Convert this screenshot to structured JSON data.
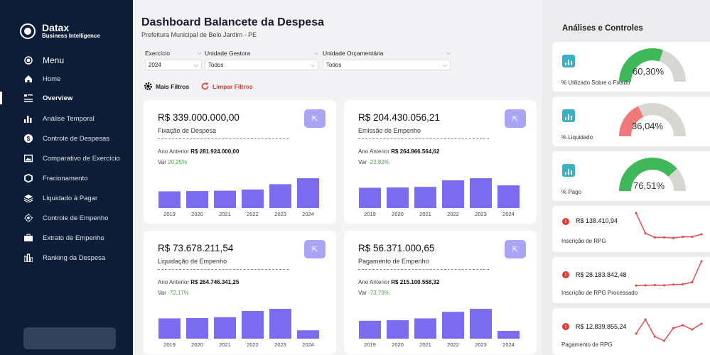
{
  "sidebar": {
    "brand_name": "Datax",
    "brand_sub": "Business Intelligence",
    "menu_label": "Menu",
    "items": [
      {
        "label": "Home"
      },
      {
        "label": "Overview"
      },
      {
        "label": "Análise Temporal"
      },
      {
        "label": "Controle de Despesas"
      },
      {
        "label": "Comparativo de Exercício"
      },
      {
        "label": "Fracionamento"
      },
      {
        "label": "Liquidado à Pagar"
      },
      {
        "label": "Controle de Empenho"
      },
      {
        "label": "Extrato de Empenho"
      },
      {
        "label": "Ranking da Despesa"
      }
    ],
    "active_item": "Overview"
  },
  "header": {
    "title": "Dashboard Balancete da Despesa",
    "subtitle": "Prefeitura Municipal de Belo Jardim - PE"
  },
  "filters": {
    "exercicio": {
      "label": "Exercício",
      "value": "2024"
    },
    "unidade_gestora": {
      "label": "Unidade Gestora",
      "value": "Todos"
    },
    "unidade_orcamentaria": {
      "label": "Unidade Orçamentária",
      "value": "Todos"
    },
    "mais_filtros": "Mais Filtros",
    "limpar_filtros": "Limpar Filtros"
  },
  "cards": [
    {
      "value": "R$ 339.000.000,00",
      "label": "Fixação de Despesa",
      "prev_label": "Ano Anterior",
      "prev_value": "R$ 281.924.000,00",
      "var_label": "Var",
      "var_value": "20,25%"
    },
    {
      "value": "R$ 204.430.056,21",
      "label": "Emissão de Empenho",
      "prev_label": "Ano Anterior",
      "prev_value": "R$ 264.866.564,62",
      "var_label": "Var",
      "var_value": "-22,82%"
    },
    {
      "value": "R$ 73.678.211,54",
      "label": "Liquidação de Empenho",
      "prev_label": "Ano Anterior",
      "prev_value": "R$ 264.746.341,25",
      "var_label": "Var",
      "var_value": "-72,17%"
    },
    {
      "value": "R$ 56.371.000,65",
      "label": "Pagamento de Empenho",
      "prev_label": "Ano Anterior",
      "prev_value": "R$ 215.100.558,32",
      "var_label": "Var",
      "var_value": "-73,79%"
    }
  ],
  "chart_data": [
    {
      "type": "bar",
      "categories": [
        "2019",
        "2020",
        "2021",
        "2022",
        "2023",
        "2024"
      ],
      "values": [
        0.56,
        0.57,
        0.58,
        0.62,
        0.8,
        1.0
      ],
      "ylim": [
        0,
        1
      ]
    },
    {
      "type": "bar",
      "categories": [
        "2019",
        "2020",
        "2021",
        "2022",
        "2023",
        "2024"
      ],
      "values": [
        0.68,
        0.69,
        0.71,
        0.93,
        1.0,
        0.76
      ],
      "ylim": [
        0,
        1
      ]
    },
    {
      "type": "bar",
      "categories": [
        "2019",
        "2020",
        "2021",
        "2022",
        "2023",
        "2024"
      ],
      "values": [
        0.68,
        0.69,
        0.72,
        0.93,
        1.0,
        0.28
      ],
      "ylim": [
        0,
        1
      ]
    },
    {
      "type": "bar",
      "categories": [
        "2019",
        "2020",
        "2021",
        "2022",
        "2023",
        "2024"
      ],
      "values": [
        0.6,
        0.62,
        0.68,
        0.9,
        1.0,
        0.26
      ],
      "ylim": [
        0,
        1
      ]
    }
  ],
  "colors": {
    "bar": "#7b6cf0",
    "gauge_green": "#3fb85a",
    "gauge_red": "#f07a7a",
    "gauge_bg": "#d8d6d0",
    "sparkline": "#e05050"
  },
  "right_panel": {
    "title": "Análises e Controles",
    "gauges": [
      {
        "value": "60,30%",
        "fraction": 0.603,
        "label": "% Utilizado Sobre o Fixado",
        "color": "#3fb85a"
      },
      {
        "value": "36,04%",
        "fraction": 0.3604,
        "label": "% Liquidado",
        "color": "#f07a7a"
      },
      {
        "value": "76,51%",
        "fraction": 0.7651,
        "label": "% Pago",
        "color": "#3fb85a"
      }
    ],
    "kpis": [
      {
        "value": "R$ 138.410,94",
        "label": "Inscrição de RPG",
        "trend": [
          1.0,
          0.35,
          0.22,
          0.22,
          0.2,
          0.24,
          0.24,
          0.32
        ]
      },
      {
        "value": "R$ 28.183.842,48",
        "label": "Inscrição de RPG Processado",
        "trend": [
          0.05,
          0.06,
          0.07,
          0.06,
          0.09,
          0.1,
          0.18,
          1.0
        ]
      },
      {
        "value": "R$ 12.839.855,24",
        "label": "Pagamento de RPG",
        "trend": [
          0.4,
          0.9,
          0.3,
          0.15,
          0.6,
          0.7,
          0.55,
          0.75
        ]
      }
    ]
  }
}
